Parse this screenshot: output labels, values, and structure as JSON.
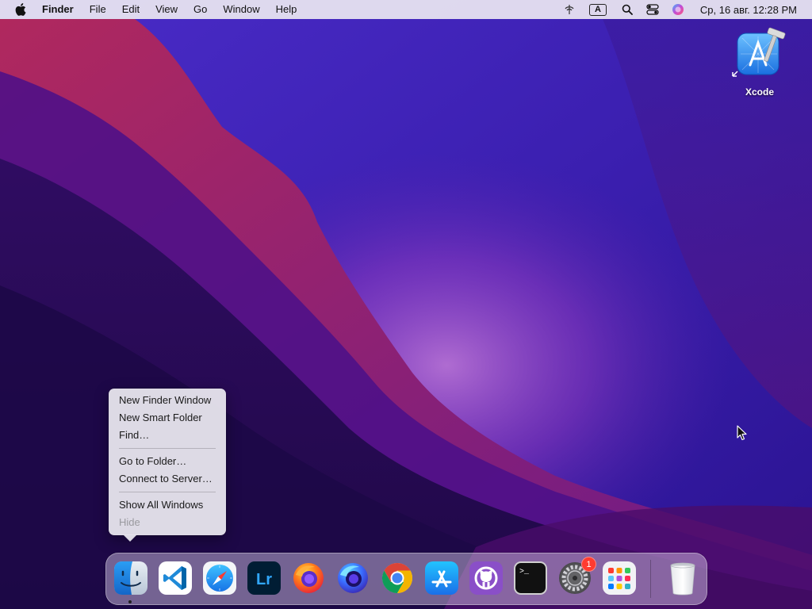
{
  "menubar": {
    "app_name": "Finder",
    "menus": [
      "File",
      "Edit",
      "View",
      "Go",
      "Window",
      "Help"
    ],
    "input_source": "A",
    "clock": "Ср, 16 авг.  12:28 PM"
  },
  "desktop": {
    "icons": [
      {
        "label": "Xcode",
        "icon": "xcode-icon"
      }
    ]
  },
  "context_menu": {
    "items": [
      {
        "label": "New Finder Window",
        "enabled": true
      },
      {
        "label": "New Smart Folder",
        "enabled": true
      },
      {
        "label": "Find…",
        "enabled": true
      },
      {
        "label": "Go to Folder…",
        "enabled": true
      },
      {
        "label": "Connect to Server…",
        "enabled": true
      },
      {
        "label": "Show All Windows",
        "enabled": true
      },
      {
        "label": "Hide",
        "enabled": false
      }
    ]
  },
  "dock": {
    "apps": [
      {
        "icon": "finder-icon",
        "running": true
      },
      {
        "icon": "vscode-icon",
        "running": false
      },
      {
        "icon": "safari-icon",
        "running": false
      },
      {
        "icon": "lightroom-icon",
        "text": "Lr",
        "running": false
      },
      {
        "icon": "firefox-icon",
        "running": false
      },
      {
        "icon": "firefox-developer-icon",
        "running": false
      },
      {
        "icon": "chrome-icon",
        "running": false
      },
      {
        "icon": "app-store-icon",
        "running": false
      },
      {
        "icon": "github-desktop-icon",
        "running": false
      },
      {
        "icon": "terminal-icon",
        "text": ">_",
        "running": false
      },
      {
        "icon": "system-settings-icon",
        "running": false,
        "badge": "1"
      },
      {
        "icon": "launchpad-icon",
        "running": false
      },
      {
        "icon": "trash-icon",
        "running": false
      }
    ]
  },
  "colors": {
    "accent": "#7b1fa2",
    "badge": "#ff3b30",
    "wallpaper_base": "#2a0d6e"
  }
}
